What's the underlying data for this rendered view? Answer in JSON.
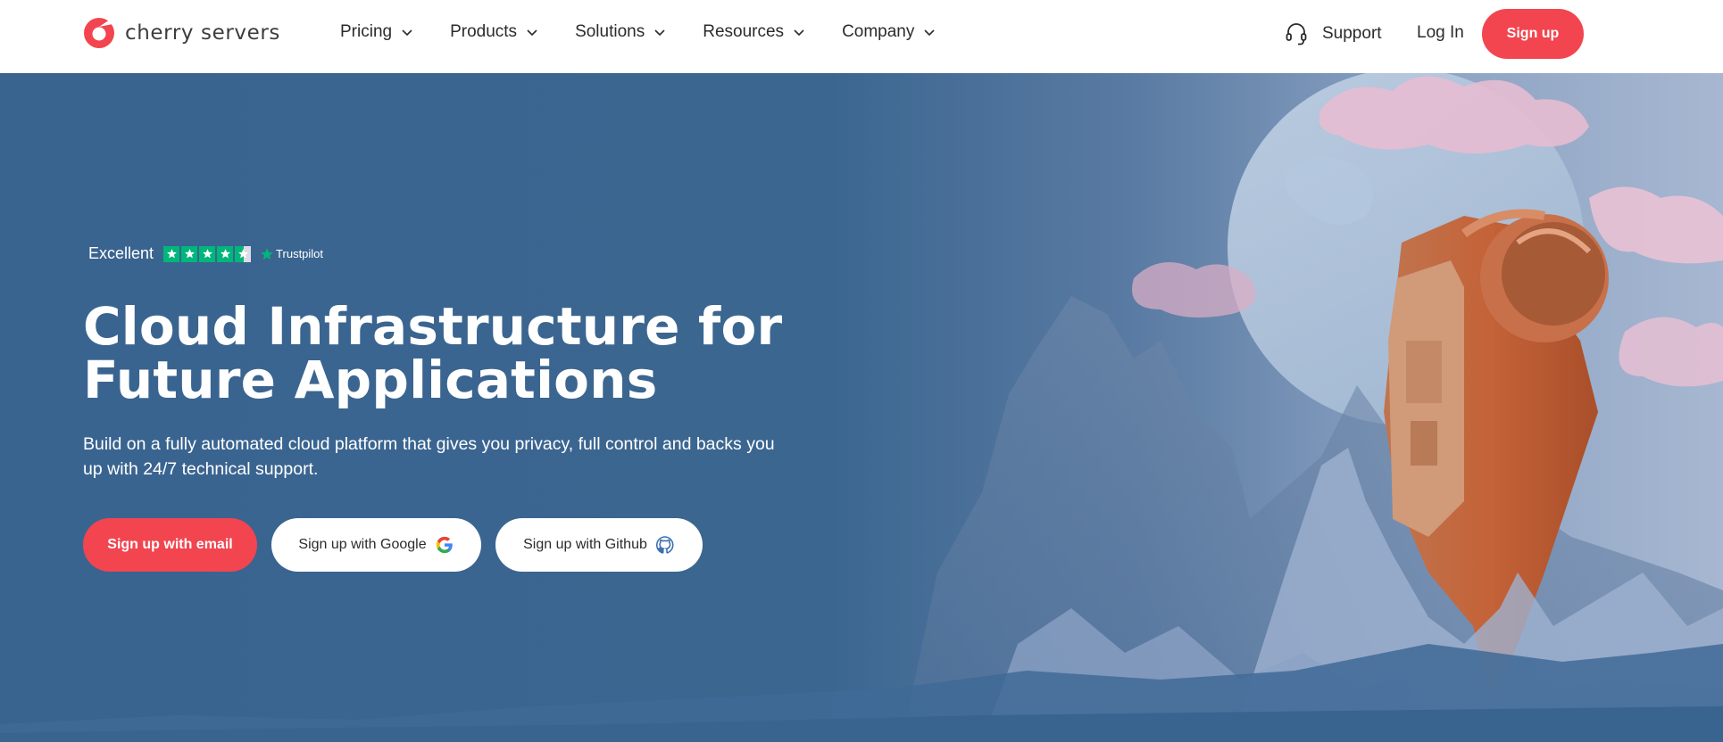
{
  "header": {
    "logo_text": "cherry servers",
    "nav": [
      {
        "label": "Pricing"
      },
      {
        "label": "Products"
      },
      {
        "label": "Solutions"
      },
      {
        "label": "Resources"
      },
      {
        "label": "Company"
      }
    ],
    "support_label": "Support",
    "login_label": "Log In",
    "signup_label": "Sign up"
  },
  "hero": {
    "rating_label": "Excellent",
    "rating_stars": 4.5,
    "trustpilot_label": "Trustpilot",
    "headline_line1": "Cloud Infrastructure for",
    "headline_line2": "Future Applications",
    "subtext_line1": "Build on a fully automated cloud platform that gives you privacy, full control and backs you",
    "subtext_line2": "up with 24/7 technical support.",
    "buttons": {
      "email": "Sign up with email",
      "google": "Sign up with Google",
      "github": "Sign up with Github"
    }
  },
  "colors": {
    "brand": "#f2454f",
    "hero_bg": "#3a6490",
    "trustpilot_green": "#00b67a"
  },
  "icons": [
    "cherry-logo-icon",
    "chevron-down-icon",
    "headset-icon",
    "star-icon",
    "google-icon",
    "github-icon"
  ]
}
